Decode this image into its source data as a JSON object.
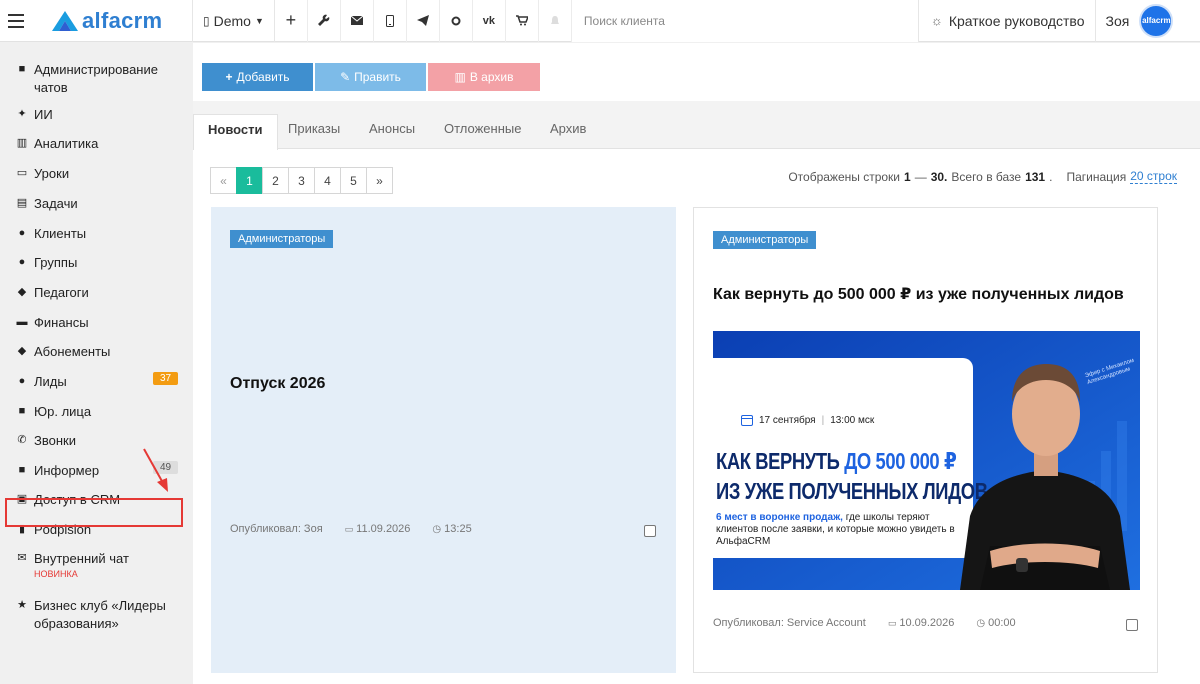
{
  "topbar": {
    "logo_text": "alfacrm",
    "branch_label": "Demo",
    "search_placeholder": "Поиск клиента",
    "guide_label": "Краткое руководство",
    "user_name": "Зоя",
    "avatar_text": "alfacrm",
    "icons": [
      "plus-icon",
      "wrench-icon",
      "mail-icon",
      "phone-icon",
      "telegram-icon",
      "odnoklassniki-icon",
      "vk-icon",
      "cart-icon",
      "bell-icon"
    ]
  },
  "sidebar": {
    "items": [
      {
        "label": "Администрирование чатов",
        "icon": "chat-icon"
      },
      {
        "label": "ИИ",
        "icon": "sparkle-icon"
      },
      {
        "label": "Аналитика",
        "icon": "map-icon"
      },
      {
        "label": "Уроки",
        "icon": "calendar-icon"
      },
      {
        "label": "Задачи",
        "icon": "clipboard-icon"
      },
      {
        "label": "Клиенты",
        "icon": "user-icon"
      },
      {
        "label": "Группы",
        "icon": "users-icon"
      },
      {
        "label": "Педагоги",
        "icon": "graduation-cap-icon"
      },
      {
        "label": "Финансы",
        "icon": "money-icon"
      },
      {
        "label": "Абонементы",
        "icon": "tag-icon"
      },
      {
        "label": "Лиды",
        "icon": "user-plus-icon",
        "badge": "37"
      },
      {
        "label": "Юр. лица",
        "icon": "briefcase-icon"
      },
      {
        "label": "Звонки",
        "icon": "phone-icon"
      },
      {
        "label": "Информер",
        "icon": "book-icon",
        "badge": "49"
      },
      {
        "label": "Доступ в CRM",
        "icon": "lock-icon"
      },
      {
        "label": "Podpislon",
        "icon": "file-icon"
      },
      {
        "label": "Внутренний чат",
        "icon": "envelope-icon",
        "note": "НОВИНКА"
      },
      {
        "label": "Бизнес клуб «Лидеры образования»",
        "icon": "star-icon"
      }
    ],
    "colors": {
      "lead_badge": "#f39c12",
      "highlight": "#e53935"
    }
  },
  "actions": {
    "add_label": "Добавить",
    "edit_label": "Править",
    "archive_label": "В архив"
  },
  "tabs": [
    "Новости",
    "Приказы",
    "Анонсы",
    "Отложенные",
    "Архив"
  ],
  "pager": {
    "prev": "«",
    "pages": [
      "1",
      "2",
      "3",
      "4",
      "5"
    ],
    "current": "1",
    "next": "»"
  },
  "stats": {
    "prefix": "Отображены строки",
    "range_start": "1",
    "dash": "—",
    "range_end": "30.",
    "total_text": "Всего в базе",
    "total": "131",
    "pagination_label": "Пагинация",
    "pagination_value": "20 строк"
  },
  "cards": [
    {
      "tag": "Администраторы",
      "title": "Отпуск 2026",
      "author": "Опубликовал: Зоя",
      "date": "11.09.2026",
      "time": "13:25"
    },
    {
      "tag": "Администраторы",
      "title": "Как вернуть до 500 000 ₽ из уже полученных лидов",
      "author": "Опубликовал: Service Account",
      "date": "10.09.2026",
      "time": "00:00",
      "banner": {
        "date": "17 сентября",
        "time": "13:00 мск",
        "headline_1": "КАК ВЕРНУТЬ",
        "headline_1_accent": "ДО 500 000 ₽",
        "headline_2": "ИЗ УЖЕ ПОЛУЧЕННЫХ ЛИДОВ",
        "sub_accent": "6 мест в воронке продаж,",
        "sub_rest": "где школы теряют клиентов после заявки, и которые можно увидеть в АльфаCRM",
        "caption": "Эфир с Михаилом Александровым"
      }
    }
  ]
}
